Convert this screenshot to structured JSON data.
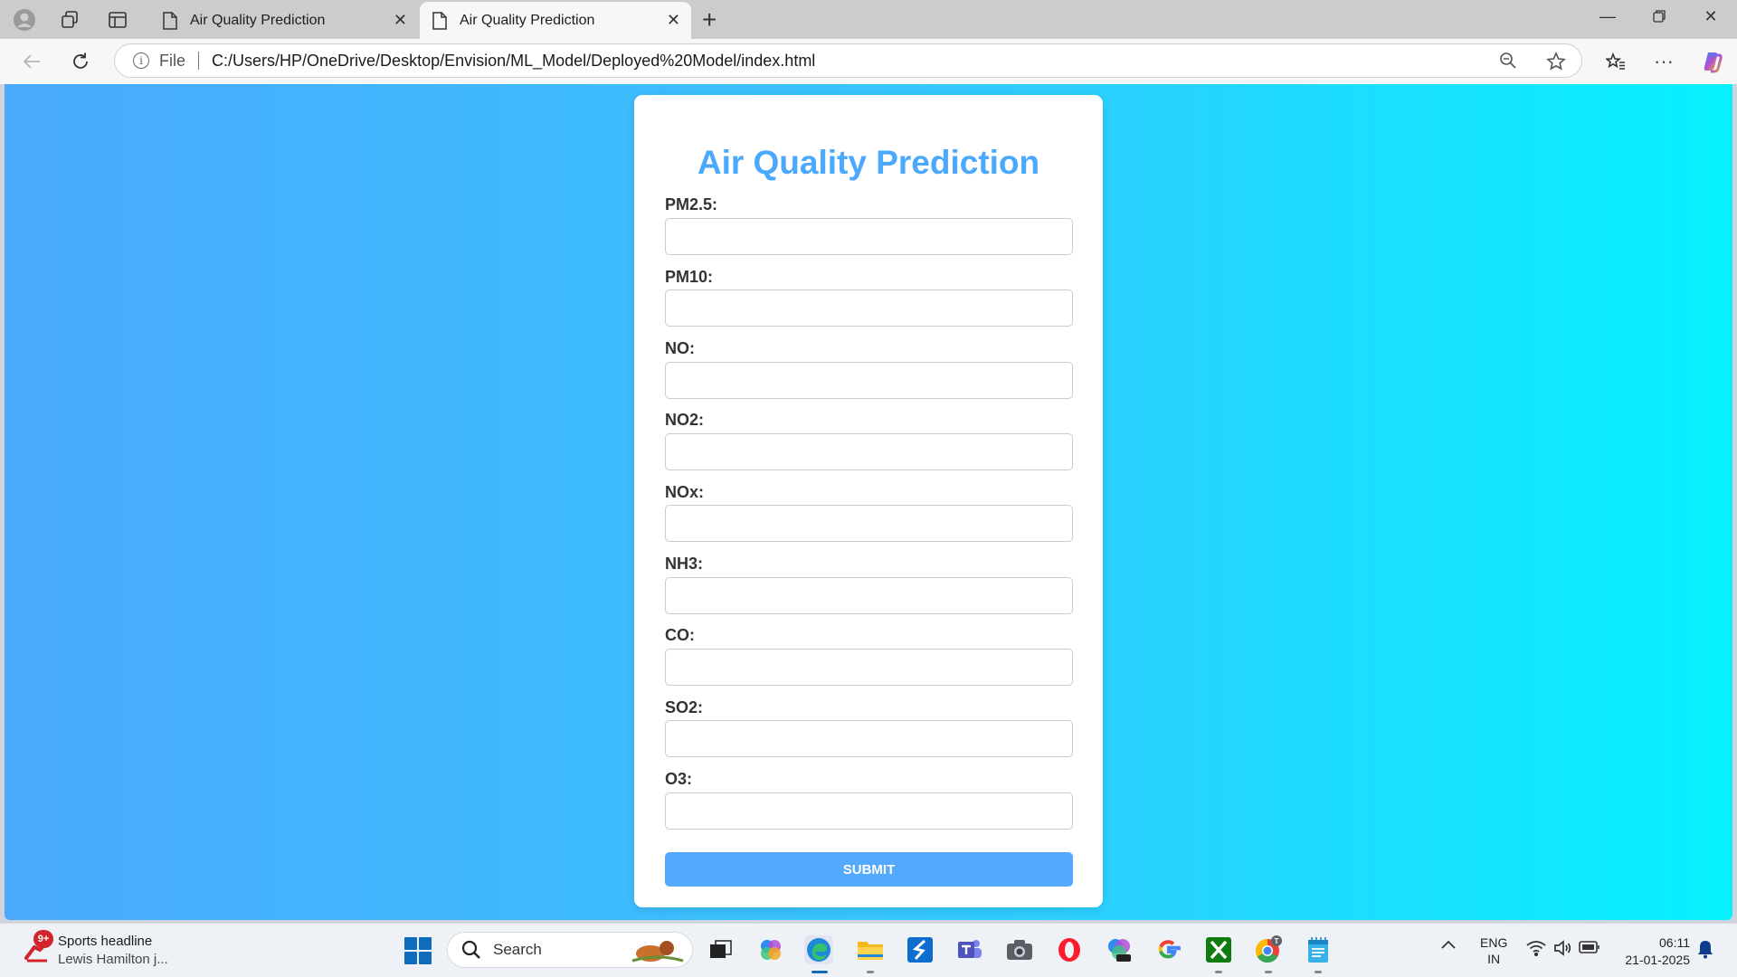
{
  "browser": {
    "tabs": [
      {
        "title": "Air Quality Prediction",
        "active": false
      },
      {
        "title": "Air Quality Prediction",
        "active": true
      }
    ],
    "address": {
      "scheme_label": "File",
      "url": "C:/Users/HP/OneDrive/Desktop/Envision/ML_Model/Deployed%20Model/index.html"
    }
  },
  "page": {
    "title": "Air Quality Prediction",
    "fields": [
      {
        "label": "PM2.5:",
        "value": ""
      },
      {
        "label": "PM10:",
        "value": ""
      },
      {
        "label": "NO:",
        "value": ""
      },
      {
        "label": "NO2:",
        "value": ""
      },
      {
        "label": "NOx:",
        "value": ""
      },
      {
        "label": "NH3:",
        "value": ""
      },
      {
        "label": "CO:",
        "value": ""
      },
      {
        "label": "SO2:",
        "value": ""
      },
      {
        "label": "O3:",
        "value": ""
      }
    ],
    "submit_label": "SUBMIT",
    "colors": {
      "accent": "#4aa9fc",
      "gradient_start": "#4aa9fc",
      "gradient_end": "#06f1fe"
    }
  },
  "taskbar": {
    "news": {
      "badge": "9+",
      "title": "Sports headline",
      "subtitle": "Lewis Hamilton j..."
    },
    "search_label": "Search",
    "language": {
      "line1": "ENG",
      "line2": "IN"
    },
    "clock": {
      "time": "06:11",
      "date": "21-01-2025"
    }
  }
}
